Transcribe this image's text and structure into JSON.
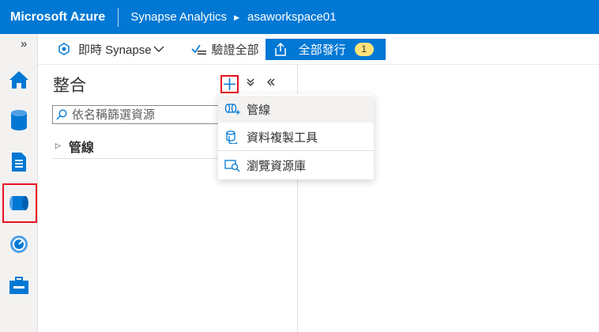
{
  "topbar": {
    "brand": "Microsoft Azure",
    "service": "Synapse Analytics",
    "workspace": "asaworkspace01"
  },
  "commandbar": {
    "live_label": "即時 Synapse",
    "validate_label": "驗證全部",
    "publish_label": "全部發行",
    "publish_count": "1"
  },
  "panel": {
    "title": "整合",
    "search_placeholder": "依名稱篩選資源",
    "tree_items": [
      {
        "label": "管線"
      }
    ]
  },
  "menu": {
    "items": [
      {
        "label": "管線",
        "icon": "pipeline-icon"
      },
      {
        "label": "資料複製工具",
        "icon": "copy-data-tool-icon"
      },
      {
        "label": "瀏覽資源庫",
        "icon": "browse-gallery-icon"
      }
    ]
  },
  "rail": {
    "expand_glyph": "»",
    "items": [
      "home-icon",
      "data-icon",
      "develop-icon",
      "integrate-icon",
      "monitor-icon",
      "manage-icon"
    ],
    "active": "integrate-icon"
  },
  "colors": {
    "azure_blue": "#0078d4",
    "highlight_red": "#e81123",
    "badge_yellow": "#ffe27a"
  }
}
